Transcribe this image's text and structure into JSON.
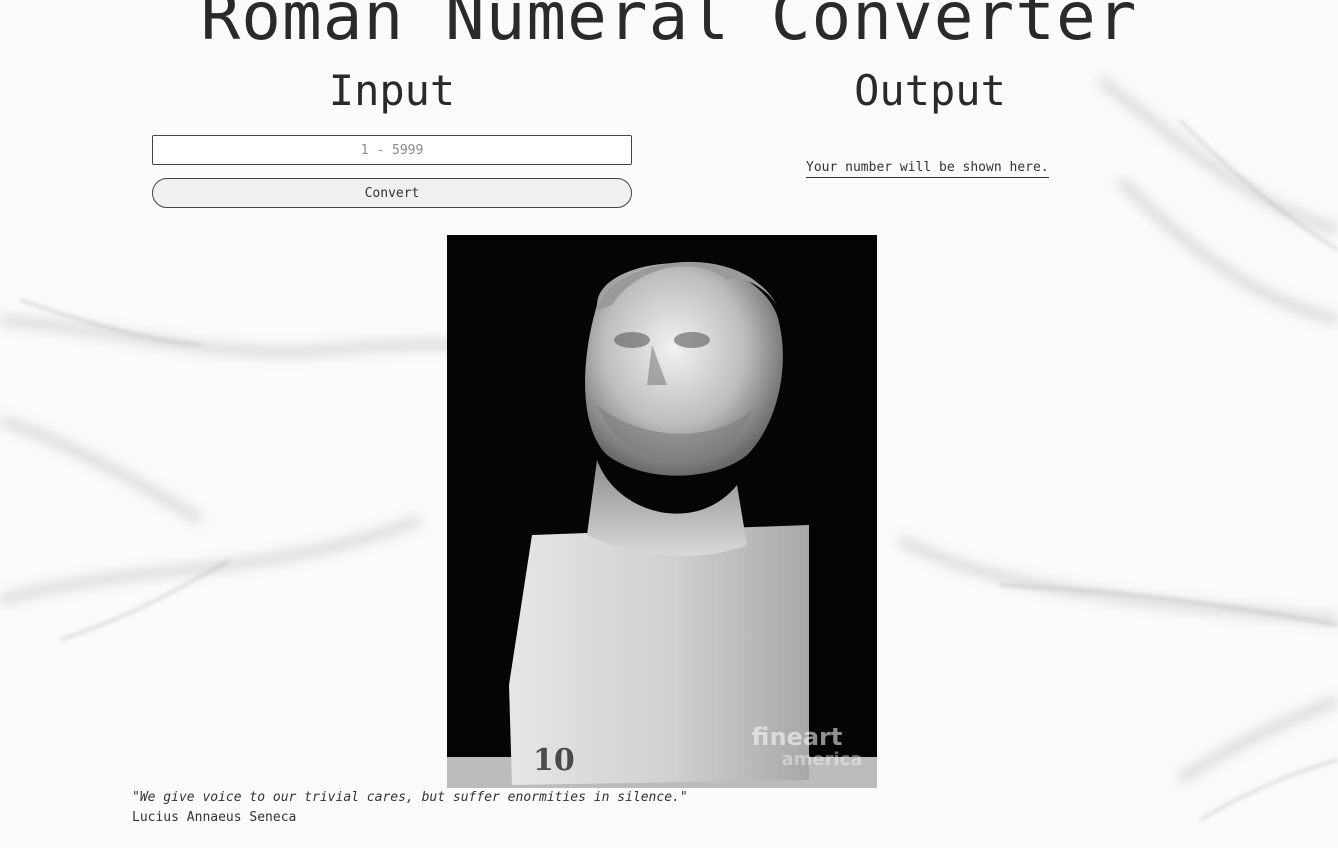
{
  "page": {
    "title": "Roman Numeral Converter"
  },
  "input": {
    "heading": "Input",
    "placeholder": "1 - 5999",
    "value": "",
    "convert_label": "Convert"
  },
  "output": {
    "heading": "Output",
    "text": "Your number will be shown here."
  },
  "image": {
    "subject": "marble bust of Seneca",
    "watermark_text": "fineart america",
    "pedestal_number": "10"
  },
  "quote": {
    "text": "\"We give voice to our trivial cares, but suffer enormities in silence.\"",
    "author": "Lucius Annaeus Seneca"
  },
  "colors": {
    "text": "#2b2b2b",
    "background": "#fbfbfb",
    "image_background": "#050505"
  }
}
